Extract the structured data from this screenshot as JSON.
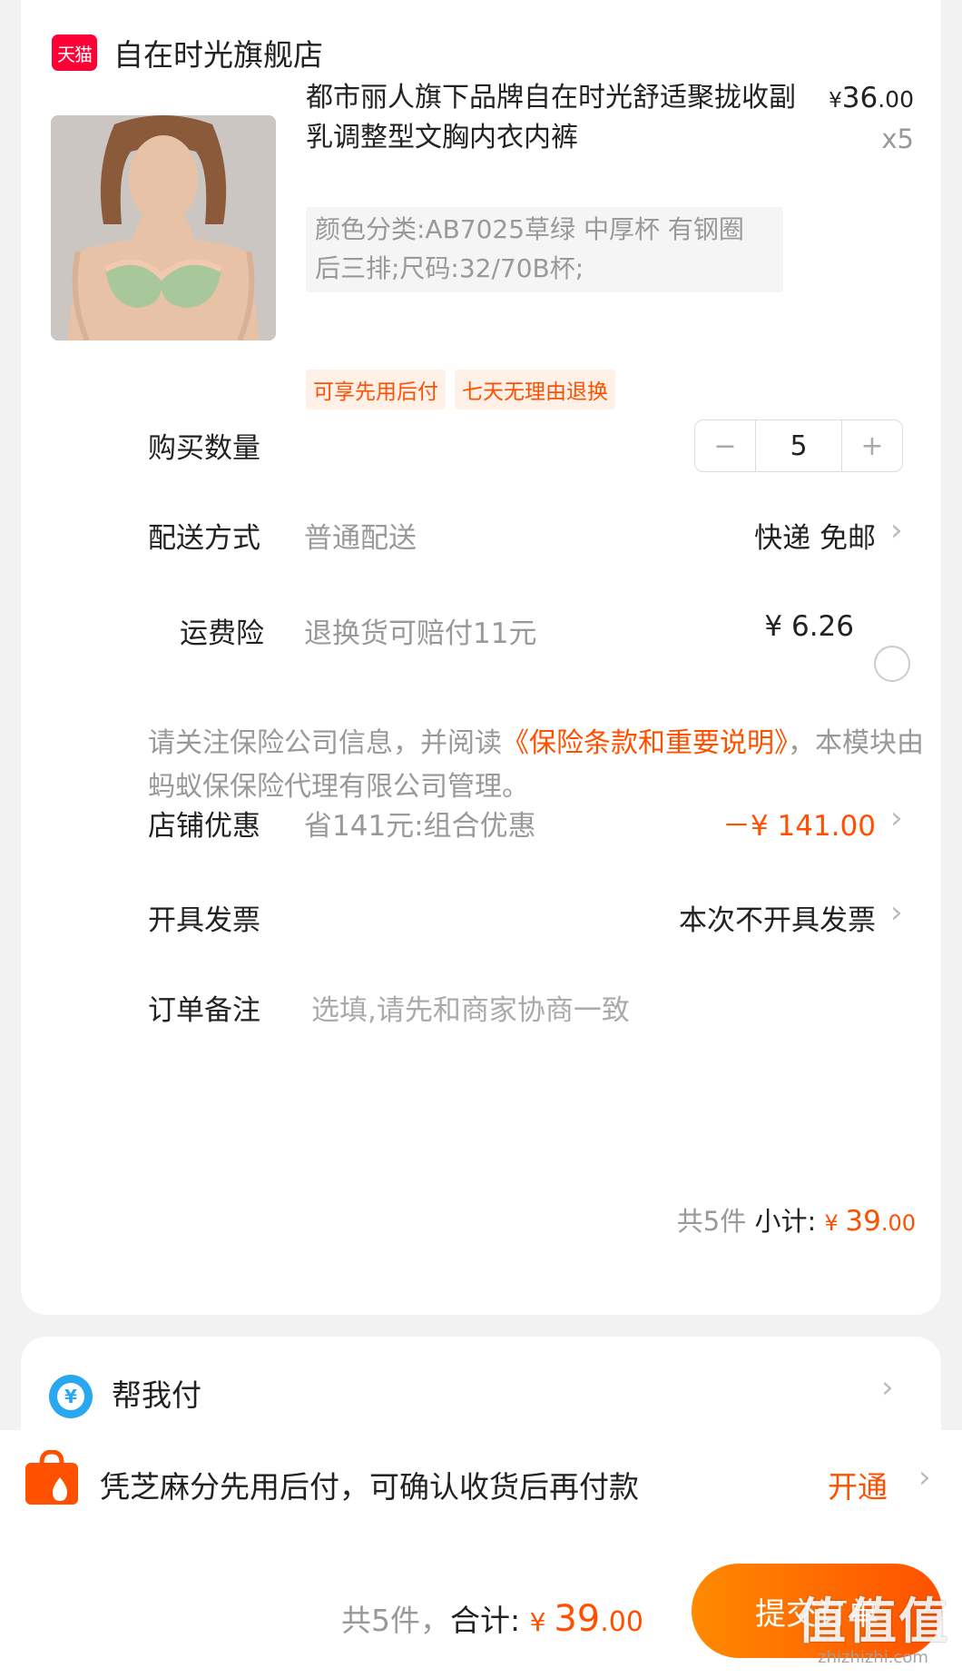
{
  "shop": {
    "badge": "天猫",
    "name": "自在时光旗舰店"
  },
  "product": {
    "title": "都市丽人旗下品牌自在时光舒适聚拢收副乳调整型文胸内衣内裤",
    "sku": "颜色分类:AB7025草绿 中厚杯 有钢圈 后三排;尺码:32/70B杯;",
    "price_currency": "¥",
    "price_int": "36",
    "price_dec": ".00",
    "qty_label": "x5",
    "tags": [
      "可享先用后付",
      "七天无理由退换"
    ]
  },
  "quantity": {
    "label": "购买数量",
    "minus": "−",
    "value": "5",
    "plus": "+"
  },
  "delivery": {
    "label": "配送方式",
    "sub": "普通配送",
    "value": "快递 免邮"
  },
  "insurance": {
    "label": "运费险",
    "sub": "退换货可赔付11元",
    "price": "¥ 6.26",
    "notice_prefix": "请关注保险公司信息，并阅读",
    "notice_link": "《保险条款和重要说明》",
    "notice_suffix": "，本模块由蚂蚁保保险代理有限公司管理。"
  },
  "discount": {
    "label": "店铺优惠",
    "sub": "省141元:组合优惠",
    "value": "－¥ 141.00"
  },
  "invoice": {
    "label": "开具发票",
    "value": "本次不开具发票"
  },
  "remark": {
    "label": "订单备注",
    "placeholder": "选填,请先和商家协商一致"
  },
  "subtotal": {
    "count": "共5件",
    "label": " 小计: ",
    "currency": "¥ ",
    "int": "39",
    "dec": ".00"
  },
  "help_pay": {
    "icon_glyph": "¥",
    "label": "帮我付"
  },
  "credit": {
    "text": "凭芝麻分先用后付，可确认收货后再付款",
    "action": "开通"
  },
  "bottom": {
    "count": "共5件，",
    "label": "合计: ",
    "currency": "¥ ",
    "int": "39",
    "dec": ".00",
    "submit": "提交订单"
  },
  "watermark": {
    "main": "值值值",
    "sub": "zhizhizhi.com"
  },
  "colors": {
    "accent": "#ff5000",
    "tmall": "#ff0036",
    "help_blue": "#2aa7f1"
  }
}
